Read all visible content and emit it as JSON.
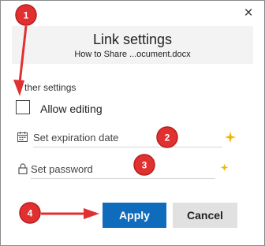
{
  "dialog": {
    "close_glyph": "×",
    "title": "Link settings",
    "subtitle": "How to Share ...ocument.docx"
  },
  "other_settings": {
    "label": "Other settings",
    "label_visible": "ther settings",
    "allow_editing": {
      "label": "Allow editing",
      "checked": false
    },
    "expiration": {
      "placeholder": "Set expiration date",
      "icon": "calendar-icon"
    },
    "password": {
      "placeholder": "Set password",
      "icon": "lock-icon"
    }
  },
  "buttons": {
    "apply_label": "Apply",
    "cancel_label": "Cancel"
  },
  "annotations": {
    "markers": [
      "1",
      "2",
      "3",
      "4"
    ],
    "marker_color": "#e03030"
  },
  "colors": {
    "primary": "#0f6cbd",
    "sparkle": "#f2b705"
  }
}
